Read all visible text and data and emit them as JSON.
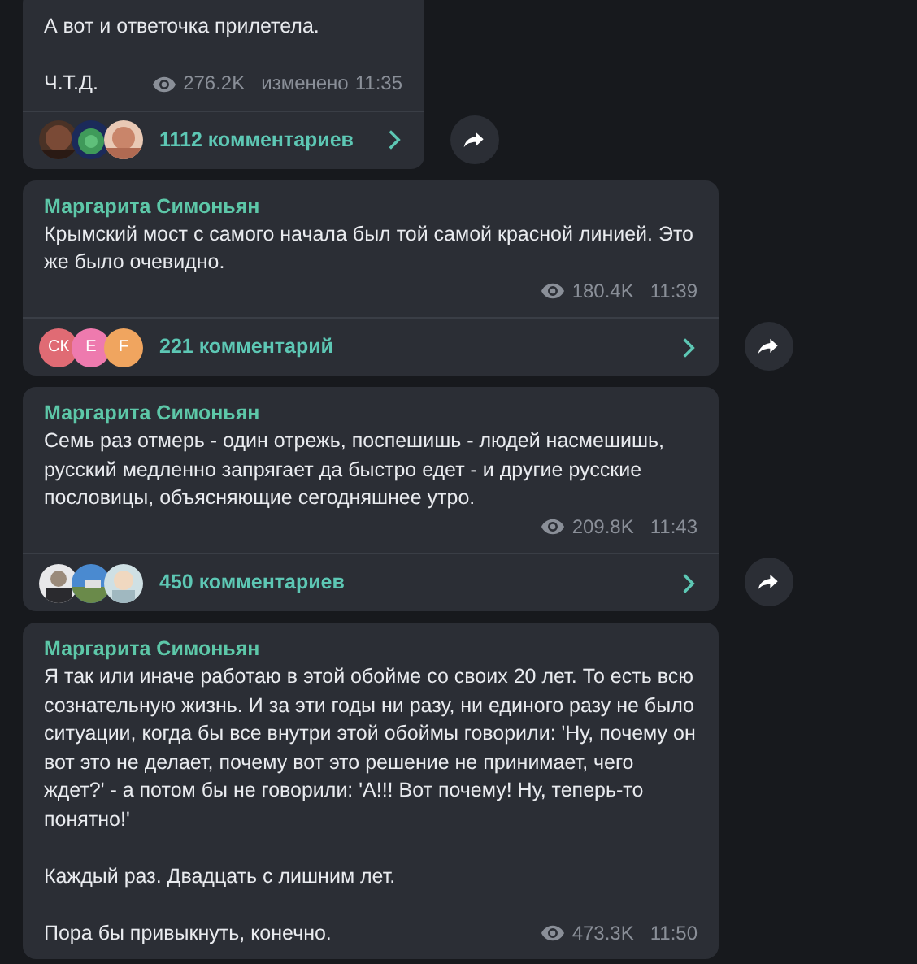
{
  "messages": [
    {
      "paragraphs": [
        "А вот и ответочка прилетела.",
        "Ч.Т.Д."
      ],
      "views": "276.2K",
      "edited": "изменено",
      "time": "11:35",
      "forward": true,
      "comments": {
        "label": "1112 комментариев"
      }
    },
    {
      "sender": "Маргарита Симоньян",
      "paragraphs": [
        "Крымский мост с самого начала был той самой красной линией. Это же было очевидно."
      ],
      "views": "180.4K",
      "time": "11:39",
      "forward": true,
      "comments": {
        "label": "221 комментарий",
        "avatars": [
          {
            "kind": "letter",
            "text": "СК",
            "color": "#e06b74"
          },
          {
            "kind": "letter",
            "text": "E",
            "color": "#ee7aae"
          },
          {
            "kind": "letter",
            "text": "F",
            "color": "#f0a55f"
          }
        ]
      }
    },
    {
      "sender": "Маргарита Симоньян",
      "paragraphs": [
        "Семь раз отмерь - один отрежь, поспешишь - людей насмешишь, русский медленно запрягает да быстро едет - и другие русские пословицы, объясняющие сегодняшнее утро."
      ],
      "views": "209.8K",
      "time": "11:43",
      "forward": true,
      "comments": {
        "label": "450 комментариев"
      }
    },
    {
      "sender": "Маргарита Симоньян",
      "paragraphs": [
        "Я так или иначе работаю в этой обойме со своих 20 лет. То есть всю  сознательную жизнь. И за эти годы ни разу, ни единого разу не было ситуации, когда бы все внутри этой обоймы говорили: 'Ну, почему он вот это не делает, почему вот это решение не принимает, чего ждет?' - а потом бы не говорили: 'А!!! Вот почему! Ну, теперь-то понятно!'",
        "Каждый раз. Двадцать с лишним лет.",
        "Пора бы привыкнуть, конечно."
      ],
      "views": "473.3K",
      "time": "11:50",
      "forward": false
    }
  ]
}
